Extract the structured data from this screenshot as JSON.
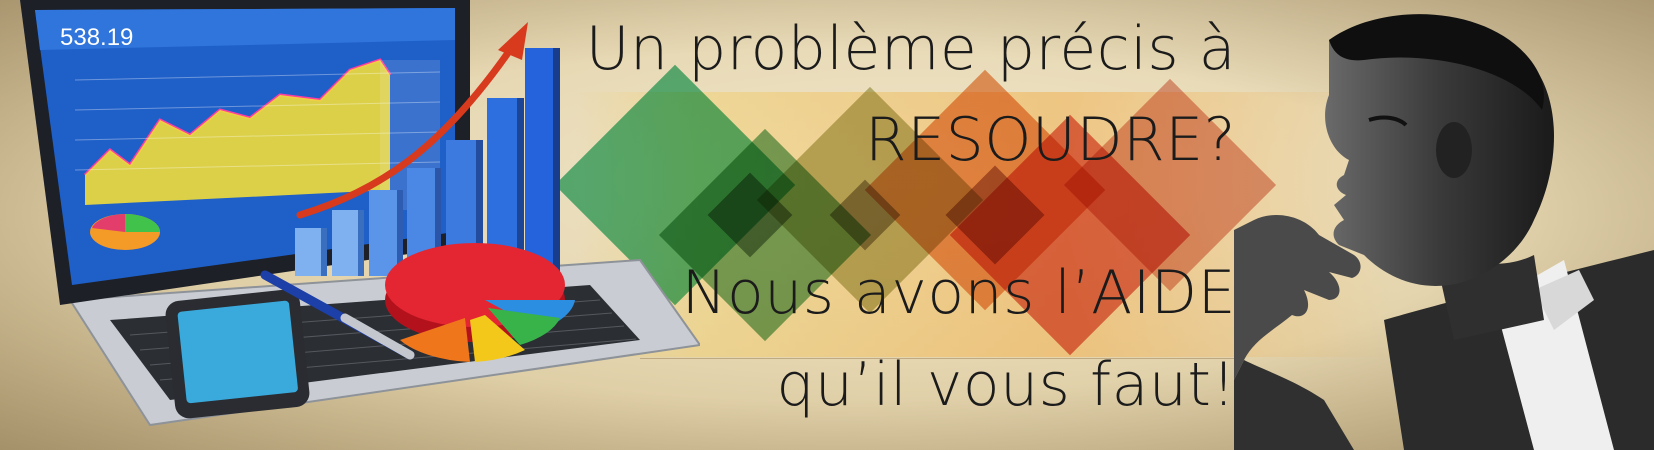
{
  "banner": {
    "headline_line1": "Un problème précis à",
    "headline_line2": "RESOUDRE?",
    "headline_line3": "Nous avons l’AIDE",
    "headline_line4": "qu’il vous faut!"
  },
  "laptop_screen": {
    "price_value": "538.19"
  },
  "colors": {
    "background": "#e6d7b1",
    "headline_text": "#1b1b1b",
    "screen_blue": "#1f5fc8",
    "bar_blue": "#2e6fe0",
    "arrow_red": "#d83a1e"
  },
  "icons": {
    "laptop": "laptop-with-financial-chart",
    "bars": "3d-blue-bar-chart",
    "arrow": "red-growth-arrow",
    "pie": "3d-pie-chart",
    "phone": "smartphone",
    "pen": "blue-pen",
    "person": "pensive-man-photo"
  }
}
